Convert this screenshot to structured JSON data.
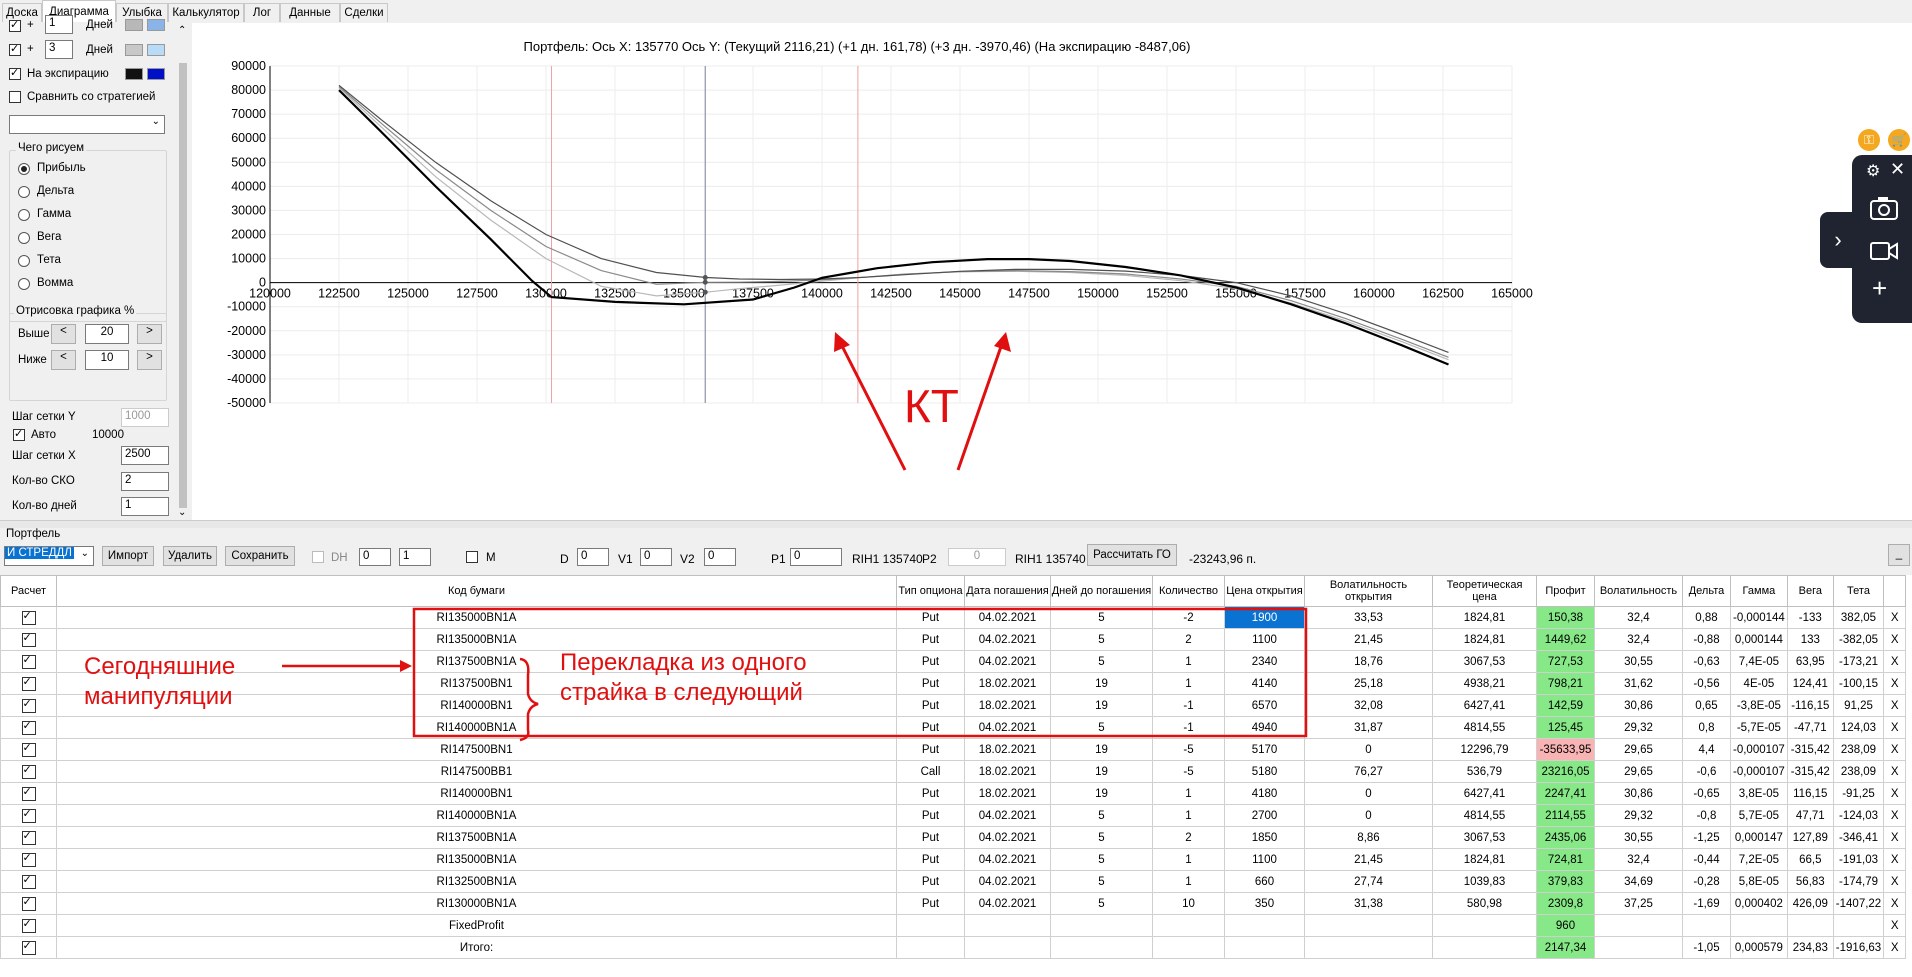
{
  "tabs": [
    "Доска",
    "Диаграмма",
    "Улыбка",
    "Калькулятор",
    "Лог",
    "Данные",
    "Сделки"
  ],
  "left": {
    "row1": {
      "plus": "+",
      "value": "1",
      "unit": "Дней"
    },
    "row2": {
      "plus": "+",
      "value": "3",
      "unit": "Дней"
    },
    "expiry_label": "На экспирацию",
    "compare_label": "Сравнить со стратегией",
    "what_group": "Чего рисуем",
    "radios": [
      "Прибыль",
      "Дельта",
      "Гамма",
      "Вега",
      "Тета",
      "Вомма"
    ],
    "render_group": "Отрисовка графика %",
    "above_label": "Выше",
    "above_value": "20",
    "below_label": "Ниже",
    "below_value": "10",
    "gridy_label": "Шаг сетки Y",
    "gridy_value": "1000",
    "auto_label": "Авто",
    "auto_value": "10000",
    "gridx_label": "Шаг сетки X",
    "gridx_value": "2500",
    "sko_label": "Кол-во СКО",
    "sko_value": "2",
    "days_label": "Кол-во дней",
    "days_value": "1",
    "btn_left": "<",
    "btn_right": ">"
  },
  "chart": {
    "header": "Портфель: Ось X: 135770 Ось Y:  (Текущий 2116,21)  (+1 дн. 161,78)  (+3 дн. -3970,46)  (На экспирацию -8487,06)"
  },
  "chart_data": {
    "type": "line",
    "xlim": [
      120000,
      165000
    ],
    "ylim": [
      -50000,
      90000
    ],
    "x_ticks": [
      "120000",
      "122500",
      "125000",
      "127500",
      "130000",
      "132500",
      "135000",
      "137500",
      "140000",
      "142500",
      "145000",
      "147500",
      "150000",
      "152500",
      "155000",
      "157500",
      "160000",
      "162500",
      "165000"
    ],
    "y_ticks": [
      "90000",
      "80000",
      "70000",
      "60000",
      "50000",
      "40000",
      "30000",
      "20000",
      "10000",
      "0",
      "-10000",
      "-20000",
      "-30000",
      "-40000",
      "-50000"
    ],
    "cursor_x": 135770,
    "red_lines_x": [
      130200,
      141300
    ],
    "series": [
      {
        "color": "#000000",
        "width": 2.2,
        "x": [
          122500,
          124000,
          126000,
          128000,
          129500,
          130200,
          132500,
          135000,
          137500,
          139000,
          140000,
          141000,
          142000,
          144000,
          146000,
          147500,
          149000,
          151000,
          153000,
          155000,
          157000,
          159000,
          161000,
          162700
        ],
        "y": [
          80000,
          63000,
          40000,
          18000,
          700,
          -6000,
          -8000,
          -9000,
          -7000,
          -2000,
          2000,
          4000,
          6000,
          8500,
          9800,
          9800,
          9000,
          6500,
          3000,
          -2000,
          -9000,
          -17000,
          -26000,
          -34000
        ]
      },
      {
        "color": "#505050",
        "width": 1.2,
        "x": [
          122500,
          124000,
          126000,
          128000,
          130000,
          132000,
          134000,
          135800,
          137000,
          138500,
          140000,
          141500,
          143000,
          145000,
          147000,
          149000,
          151000,
          153000,
          155000,
          157000,
          159000,
          161000,
          162700
        ],
        "y": [
          82000,
          68000,
          50000,
          34000,
          20000,
          10000,
          4200,
          2116,
          1500,
          1300,
          1500,
          2200,
          3300,
          4700,
          5500,
          5500,
          4800,
          3000,
          0,
          -5500,
          -13000,
          -21500,
          -29000
        ]
      },
      {
        "color": "#8a8a8a",
        "width": 1.2,
        "x": [
          122500,
          124000,
          126000,
          128000,
          130000,
          132000,
          134000,
          135800,
          137000,
          138500,
          140000,
          141500,
          143000,
          145000,
          147000,
          149000,
          151000,
          153000,
          155000,
          157000,
          159000,
          161000,
          162700
        ],
        "y": [
          81500,
          66500,
          47000,
          30000,
          15000,
          5000,
          -700,
          162,
          200,
          500,
          1200,
          2200,
          3500,
          4600,
          5000,
          4600,
          3600,
          1500,
          -1500,
          -7500,
          -15000,
          -23500,
          -31000
        ]
      },
      {
        "color": "#b8b8b8",
        "width": 1.2,
        "x": [
          122500,
          124000,
          126000,
          128000,
          130000,
          132000,
          134000,
          135800,
          137000,
          138500,
          140000,
          141500,
          143000,
          145000,
          147000,
          149000,
          151000,
          153000,
          155000,
          157000,
          159000,
          161000,
          162700
        ],
        "y": [
          81000,
          65000,
          44000,
          26000,
          10000,
          -1500,
          -5500,
          -3970,
          -2500,
          -1000,
          600,
          2200,
          3600,
          4500,
          4700,
          4200,
          3000,
          800,
          -2500,
          -8500,
          -16000,
          -24500,
          -32000
        ]
      }
    ]
  },
  "annotations": {
    "kt": "КТ",
    "today": "Сегодняшние\nманипуляции",
    "roll": "Перекладка из одного\nстрайка в следующий"
  },
  "toolbar": {
    "panel_label": "Портфель",
    "strategy": "И СТРЕДДЛ",
    "import": "Импорт",
    "delete": "Удалить",
    "save": "Сохранить",
    "dh": "DH",
    "dh_v1": "0",
    "dh_v2": "1",
    "m": "M",
    "d": "D",
    "d_val": "0",
    "v1": "V1",
    "v1_val": "0",
    "v2": "V2",
    "v2_val": "0",
    "p1": "P1",
    "p1_val": "0",
    "rih1a": "RIH1 135740",
    "p2": "P2",
    "p2_val": "0",
    "rih1b": "RIH1 135740",
    "calc": "Рассчитать ГО",
    "go_value": "-23243,96 п.",
    "minimize": "_"
  },
  "table": {
    "headers": [
      "Расчет",
      "Код бумаги",
      "Тип опциона",
      "Дата погашения",
      "Дней до погашения",
      "Количество",
      "Цена открытия",
      "Волатильность открытия",
      "Теоретическая цена",
      "Профит",
      "Волатильность",
      "Дельта",
      "Гамма",
      "Вега",
      "Тета",
      ""
    ],
    "rows": [
      [
        "RI135000BN1A",
        "Put",
        "04.02.2021",
        "5",
        "-2",
        "1900",
        "33,53",
        "1824,81",
        "150,38",
        "32,4",
        "0,88",
        "-0,000144",
        "-133",
        "382,05"
      ],
      [
        "RI135000BN1A",
        "Put",
        "04.02.2021",
        "5",
        "2",
        "1100",
        "21,45",
        "1824,81",
        "1449,62",
        "32,4",
        "-0,88",
        "0,000144",
        "133",
        "-382,05"
      ],
      [
        "RI137500BN1A",
        "Put",
        "04.02.2021",
        "5",
        "1",
        "2340",
        "18,76",
        "3067,53",
        "727,53",
        "30,55",
        "-0,63",
        "7,4E-05",
        "63,95",
        "-173,21"
      ],
      [
        "RI137500BN1",
        "Put",
        "18.02.2021",
        "19",
        "1",
        "4140",
        "25,18",
        "4938,21",
        "798,21",
        "31,62",
        "-0,56",
        "4E-05",
        "124,41",
        "-100,15"
      ],
      [
        "RI140000BN1",
        "Put",
        "18.02.2021",
        "19",
        "-1",
        "6570",
        "32,08",
        "6427,41",
        "142,59",
        "30,86",
        "0,65",
        "-3,8E-05",
        "-116,15",
        "91,25"
      ],
      [
        "RI140000BN1A",
        "Put",
        "04.02.2021",
        "5",
        "-1",
        "4940",
        "31,87",
        "4814,55",
        "125,45",
        "29,32",
        "0,8",
        "-5,7E-05",
        "-47,71",
        "124,03"
      ],
      [
        "RI147500BN1",
        "Put",
        "18.02.2021",
        "19",
        "-5",
        "5170",
        "0",
        "12296,79",
        "-35633,95",
        "29,65",
        "4,4",
        "-0,000107",
        "-315,42",
        "238,09"
      ],
      [
        "RI147500BB1",
        "Call",
        "18.02.2021",
        "19",
        "-5",
        "5180",
        "76,27",
        "536,79",
        "23216,05",
        "29,65",
        "-0,6",
        "-0,000107",
        "-315,42",
        "238,09"
      ],
      [
        "RI140000BN1",
        "Put",
        "18.02.2021",
        "19",
        "1",
        "4180",
        "0",
        "6427,41",
        "2247,41",
        "30,86",
        "-0,65",
        "3,8E-05",
        "116,15",
        "-91,25"
      ],
      [
        "RI140000BN1A",
        "Put",
        "04.02.2021",
        "5",
        "1",
        "2700",
        "0",
        "4814,55",
        "2114,55",
        "29,32",
        "-0,8",
        "5,7E-05",
        "47,71",
        "-124,03"
      ],
      [
        "RI137500BN1A",
        "Put",
        "04.02.2021",
        "5",
        "2",
        "1850",
        "8,86",
        "3067,53",
        "2435,06",
        "30,55",
        "-1,25",
        "0,000147",
        "127,89",
        "-346,41"
      ],
      [
        "RI135000BN1A",
        "Put",
        "04.02.2021",
        "5",
        "1",
        "1100",
        "21,45",
        "1824,81",
        "724,81",
        "32,4",
        "-0,44",
        "7,2E-05",
        "66,5",
        "-191,03"
      ],
      [
        "RI132500BN1A",
        "Put",
        "04.02.2021",
        "5",
        "1",
        "660",
        "27,74",
        "1039,83",
        "379,83",
        "34,69",
        "-0,28",
        "5,8E-05",
        "56,83",
        "-174,79"
      ],
      [
        "RI130000BN1A",
        "Put",
        "04.02.2021",
        "5",
        "10",
        "350",
        "31,38",
        "580,98",
        "2309,8",
        "37,25",
        "-1,69",
        "0,000402",
        "426,09",
        "-1407,22"
      ],
      [
        "FixedProfit",
        "",
        "",
        "",
        "",
        "",
        "",
        "",
        "960",
        "",
        "",
        "",
        "",
        ""
      ],
      [
        "Итого:",
        "",
        "",
        "",
        "",
        "",
        "",
        "",
        "2147,34",
        "",
        "-1,05",
        "0,000579",
        "234,83",
        "-1916,63"
      ]
    ],
    "delete_mark": "X"
  }
}
